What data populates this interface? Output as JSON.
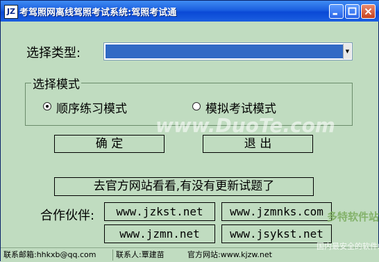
{
  "window": {
    "icon_text": "JZ",
    "title": "考驾照网离线驾照考试系统:驾照考试通"
  },
  "form": {
    "type_label": "选择类型:",
    "type_value": "",
    "mode_group_title": "选择模式",
    "mode_options": [
      {
        "label": "顺序练习模式",
        "selected": true
      },
      {
        "label": "模拟考试模式",
        "selected": false
      }
    ]
  },
  "buttons": {
    "ok": "确 定",
    "exit": "退 出",
    "check_updates": "去官方网站看看,有没有更新试题了"
  },
  "partners": {
    "label": "合作伙伴:",
    "links": [
      "www.jzkst.net",
      "www.jzmnks.com",
      "www.jzmn.net",
      "www.jsykst.net"
    ]
  },
  "statusbar": {
    "email": "联系邮箱:hhkxb@qq.com",
    "contact": "联系人:覃建苗",
    "website": "官方网站:www.kjzw.net"
  },
  "watermarks": {
    "center": "www.DuoTe.com",
    "corner_brand": "多特软件站",
    "corner_slogan": "国内最安全的软件站"
  },
  "colors": {
    "window_bg": "#c0dcc0",
    "titlebar": "#0a49d6",
    "selection": "#316ac5"
  }
}
